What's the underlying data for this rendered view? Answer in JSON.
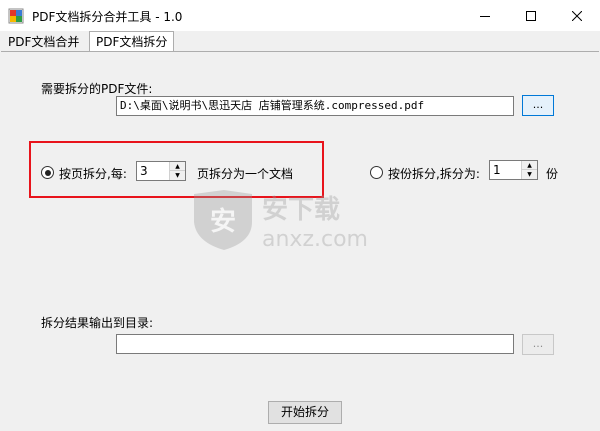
{
  "window": {
    "title": "PDF文档拆分合并工具 - 1.0",
    "controls": {
      "minimize": "minimize-icon",
      "maximize": "maximize-icon",
      "close": "close-icon"
    }
  },
  "tabs": [
    {
      "label": "PDF文档合并",
      "selected": false
    },
    {
      "label": "PDF文档拆分",
      "selected": true
    }
  ],
  "split": {
    "file_label": "需要拆分的PDF文件:",
    "file_path": "D:\\桌面\\说明书\\思迅天店 店铺管理系统.compressed.pdf",
    "browse_label": "...",
    "by_page": {
      "label": "按页拆分,每:",
      "value": "3",
      "suffix": "页拆分为一个文档",
      "selected": true
    },
    "by_count": {
      "label": "按份拆分,拆分为:",
      "value": "1",
      "suffix": "份",
      "selected": false
    },
    "output_label": "拆分结果输出到目录:",
    "output_path": "",
    "output_browse_label": "...",
    "start_label": "开始拆分"
  },
  "watermark": {
    "text": "anxz.com"
  },
  "colors": {
    "highlight": "#e8131b",
    "accent": "#0078d7"
  }
}
